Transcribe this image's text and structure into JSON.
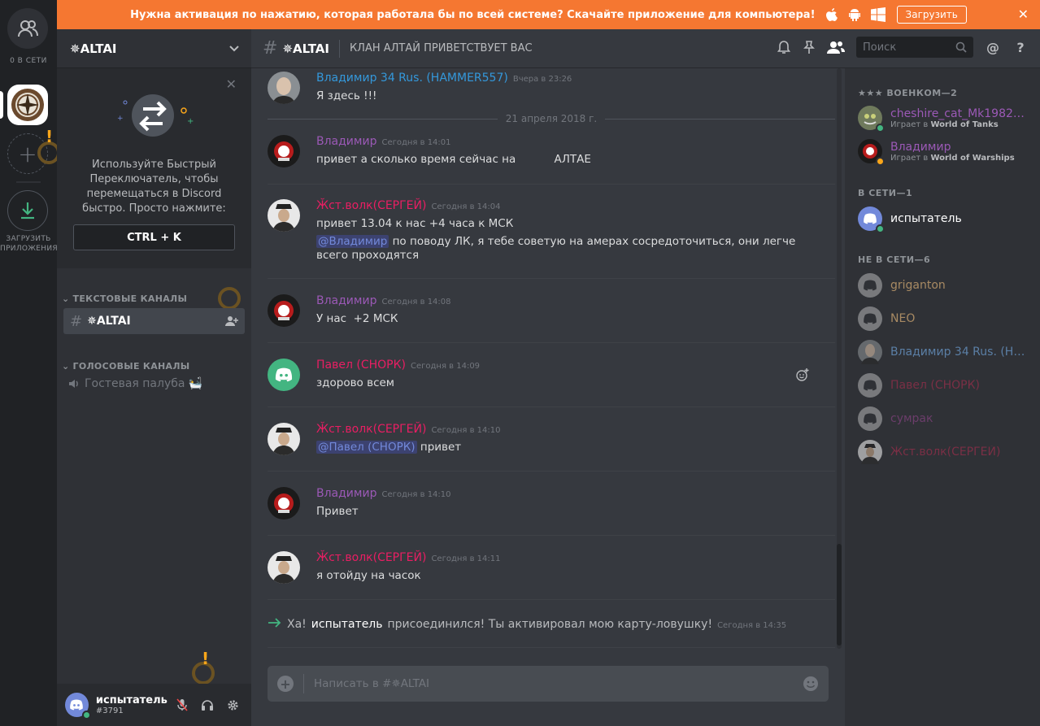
{
  "banner": {
    "text": "Нужна активация по нажатию, которая работала бы по всей системе? Скачайте приложение для компьютера!",
    "download_label": "Загрузить"
  },
  "guild_rail": {
    "online_label": "0 В СЕТИ",
    "download_label_line1": "ЗАГРУЗИТЬ",
    "download_label_line2": "ПРИЛОЖЕНИЯ"
  },
  "guild": {
    "name": "✵ALTAI"
  },
  "switcher": {
    "tip": "Используйте Быстрый Переключатель, чтобы перемещаться в Discord быстро. Просто нажмите:",
    "shortcut": "CTRL + K"
  },
  "channels": {
    "text_category": "ТЕКСТОВЫЕ КАНАЛЫ",
    "active_channel": "✵ALTAI",
    "voice_category": "ГОЛОСОВЫЕ КАНАЛЫ",
    "voice_channel": "Гостевая палуба 🛀"
  },
  "user": {
    "name": "испытатель",
    "tag": "#3791"
  },
  "chat": {
    "channel_name": "✵ALTAI",
    "topic": "КЛАН АЛТАЙ ПРИВЕТСТВУЕТ ВАС",
    "search_placeholder": "Поиск",
    "composer_placeholder": "Написать в #✵ALTAI",
    "date_divider": "21 апреля 2018 г.",
    "messages": [
      {
        "author": "Владимир 34 Rus. (HAMMER557)",
        "time": "Вчера в 23:26",
        "text": "Я здесь !!!"
      },
      {
        "author": "Владимир",
        "time": "Сегодня в 14:01",
        "text": "привет а сколько время сейчас на           АЛТАЕ"
      },
      {
        "author": "Ӂст.волк(СЕРГЕЙ)",
        "time": "Сегодня в 14:04",
        "text": "привет 13.04 к нас +4 часа к МСК",
        "mention": "@Владимир",
        "text2": "по поводу ЛК, я тебе советую на амерах сосредоточиться, они легче всего проходятся"
      },
      {
        "author": "Владимир",
        "time": "Сегодня в 14:08",
        "text": "У нас  +2 МСК"
      },
      {
        "author": "Павел (СНОРК)",
        "time": "Сегодня в 14:09",
        "text": "здорово всем"
      },
      {
        "author": "Ӂст.волк(СЕРГЕЙ)",
        "time": "Сегодня в 14:10",
        "mention": "@Павел (СНОРК)",
        "text": "привет"
      },
      {
        "author": "Владимир",
        "time": "Сегодня в 14:10",
        "text": "Привет"
      },
      {
        "author": "Ӂст.волк(СЕРГЕЙ)",
        "time": "Сегодня в 14:11",
        "text": "я отойду на часок"
      }
    ],
    "system": {
      "prefix": "Ха!",
      "user": "испытатель",
      "text": "присоединился! Ты активировал мою карту-ловушку!",
      "time": "Сегодня в 14:35"
    }
  },
  "members": {
    "cat_voenkom": "★★★ ВОЕНКОМ—2",
    "cat_online": "В СЕТИ—1",
    "cat_offline": "НЕ В СЕТИ—6",
    "playing_prefix": "Играет в",
    "list": [
      {
        "name": "cheshire_cat_Mk1982(…",
        "game": "World of Tanks"
      },
      {
        "name": "Владимир",
        "game": "World of Warships"
      },
      {
        "name": "испытатель"
      },
      {
        "name": "griganton"
      },
      {
        "name": "NEO"
      },
      {
        "name": "Владимир 34 Rus. (HA…"
      },
      {
        "name": "Павел (СНОРК)"
      },
      {
        "name": "сумрак"
      },
      {
        "name": "Ӂст.волк(СЕРГЕЙ)"
      }
    ]
  },
  "colors": {
    "banner": "#f57731",
    "violet": "#9b59b6",
    "red": "#e91e63",
    "blue": "#3498db",
    "online": "#43b581",
    "idle": "#faa61a"
  }
}
